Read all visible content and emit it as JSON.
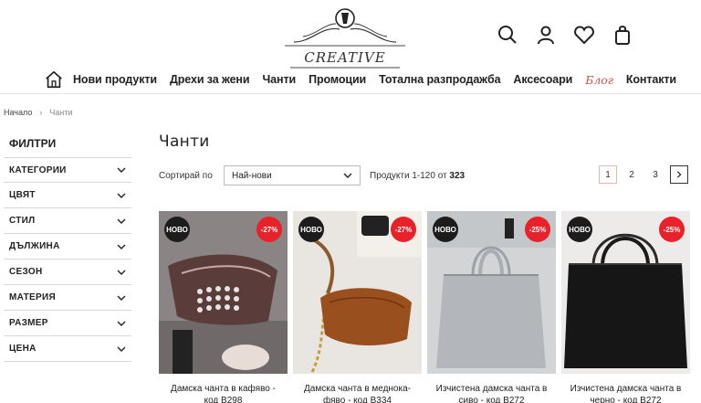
{
  "header": {
    "logo_text": "CREATIVE",
    "icons": [
      "search-icon",
      "user-icon",
      "heart-icon",
      "bag-icon"
    ]
  },
  "nav": {
    "items": [
      "Нови продукти",
      "Дрехи за жени",
      "Чанти",
      "Промоции",
      "Тотална разпродажба",
      "Аксесоари",
      "Блог",
      "Контакти"
    ]
  },
  "breadcrumb": {
    "home": "Начало",
    "current": "Чанти"
  },
  "sidebar": {
    "title": "ФИЛТРИ",
    "filters": [
      "КАТЕГОРИИ",
      "ЦВЯТ",
      "СТИЛ",
      "ДЪЛЖИНА",
      "СЕЗОН",
      "МАТЕРИЯ",
      "РАЗМЕР",
      "ЦЕНА"
    ]
  },
  "main": {
    "title": "Чанти",
    "sort_label": "Сортирай по",
    "sort_value": "Най-нови",
    "products_label": "Продукти 1-120 от",
    "products_total": "323",
    "pages": [
      "1",
      "2",
      "3"
    ]
  },
  "products": [
    {
      "badge": "НОВО",
      "discount": "-27%",
      "name": "Дамска чанта в кафяво - код B298"
    },
    {
      "badge": "НОВО",
      "discount": "-27%",
      "name": "Дамска чанта в меднока-фяво - код B334"
    },
    {
      "badge": "НОВО",
      "discount": "-25%",
      "name": "Изчистена дамска чанта в сиво - код B272"
    },
    {
      "badge": "НОВО",
      "discount": "-25%",
      "name": "Изчистена дамска чанта в черно - код B272"
    }
  ],
  "colors": {
    "accent": "#e8222b",
    "blog": "#c9544a",
    "badge_dark": "#1c1c1c"
  }
}
